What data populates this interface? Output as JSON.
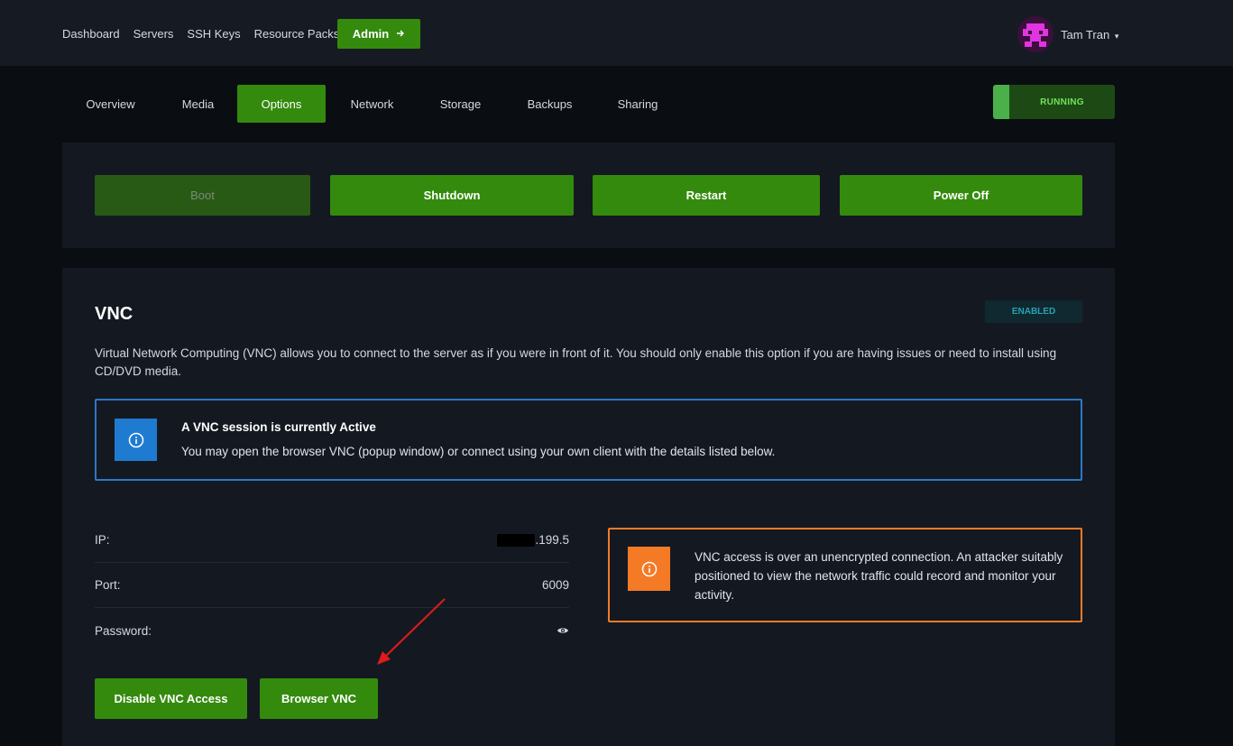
{
  "topnav": {
    "items": [
      {
        "label": "Dashboard"
      },
      {
        "label": "Servers"
      },
      {
        "label": "SSH Keys"
      },
      {
        "label": "Resource Packs"
      }
    ],
    "admin_label": "Admin",
    "admin_icon": "arrow-right-icon",
    "user_name": "Tam Tran",
    "user_caret": "▾"
  },
  "tabs": [
    {
      "label": "Overview"
    },
    {
      "label": "Media"
    },
    {
      "label": "Options",
      "active": true
    },
    {
      "label": "Network"
    },
    {
      "label": "Storage"
    },
    {
      "label": "Backups"
    },
    {
      "label": "Sharing"
    }
  ],
  "status": {
    "label": "RUNNING",
    "color": "#4ab04a"
  },
  "power": {
    "boot": "Boot",
    "shutdown": "Shutdown",
    "restart": "Restart",
    "power_off": "Power Off"
  },
  "vnc": {
    "title": "VNC",
    "badge": "ENABLED",
    "description": "Virtual Network Computing (VNC) allows you to connect to the server as if you were in front of it. You should only enable this option if you are having issues or need to install using CD/DVD media.",
    "info_title": "A VNC session is currently Active",
    "info_text": "You may open the browser VNC (popup window) or connect using your own client with the details listed below.",
    "ip_label": "IP:",
    "ip_value_visible": ".199.5",
    "port_label": "Port:",
    "port_value": "6009",
    "password_label": "Password:",
    "warning_text": "VNC access is over an unencrypted connection. An attacker suitably positioned to view the network traffic could record and monitor your activity.",
    "disable_button": "Disable VNC Access",
    "browser_button": "Browser VNC"
  },
  "colors": {
    "accent_green": "#348a0d",
    "info_blue": "#1f7bd0",
    "warning_orange": "#f47a26",
    "annotation_red": "#e01b1b"
  }
}
